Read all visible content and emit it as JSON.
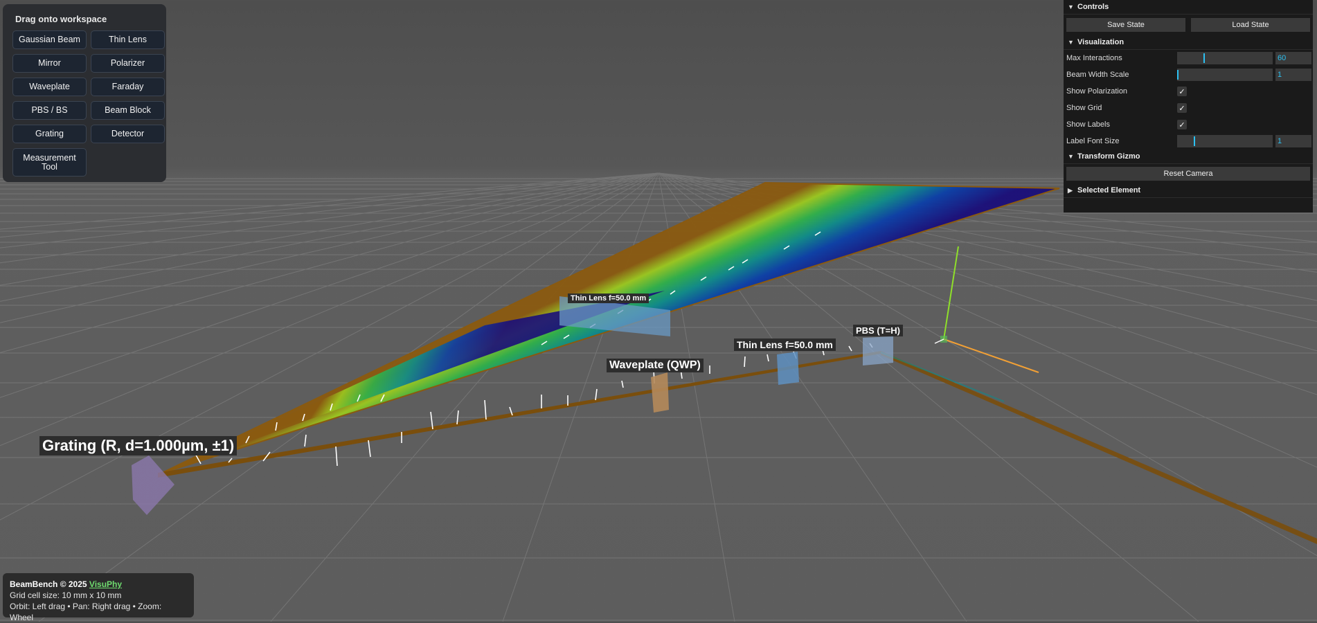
{
  "palette": {
    "title": "Drag onto workspace",
    "items": [
      {
        "label": "Gaussian Beam"
      },
      {
        "label": "Thin Lens"
      },
      {
        "label": "Mirror"
      },
      {
        "label": "Polarizer"
      },
      {
        "label": "Waveplate"
      },
      {
        "label": "Faraday"
      },
      {
        "label": "PBS / BS"
      },
      {
        "label": "Beam Block"
      },
      {
        "label": "Grating"
      },
      {
        "label": "Detector"
      },
      {
        "label": "Measurement Tool"
      }
    ]
  },
  "controls": {
    "title": "Controls",
    "save_label": "Save State",
    "load_label": "Load State",
    "visualization": {
      "title": "Visualization",
      "max_interactions_label": "Max Interactions",
      "max_interactions_value": "60",
      "beam_width_scale_label": "Beam Width Scale",
      "beam_width_scale_value": "1",
      "show_polarization_label": "Show Polarization",
      "show_grid_label": "Show Grid",
      "show_labels_label": "Show Labels",
      "label_font_size_label": "Label Font Size",
      "label_font_size_value": "1",
      "check_mark": "✓"
    },
    "transform_gizmo": {
      "title": "Transform Gizmo",
      "reset_camera_label": "Reset Camera"
    },
    "selected_element": {
      "title": "Selected Element"
    }
  },
  "scene_labels": {
    "grating": "Grating (R, d=1.000µm, ±1)",
    "thin_lens_far": "Thin Lens f=50.0 mm",
    "waveplate": "Waveplate (QWP)",
    "thin_lens_near": "Thin Lens f=50.0 mm",
    "pbs": "PBS (T=H)"
  },
  "info": {
    "app": "BeamBench © 2025",
    "link": "VisuPhy",
    "grid": "Grid cell size: 10 mm x 10 mm",
    "help": "Orbit: Left drag • Pan: Right drag • Zoom: Wheel"
  },
  "colors": {
    "beam_main": "#8a5a10",
    "spectrum": [
      "#1a0e7a",
      "#0b3fa8",
      "#0e8c8a",
      "#2fb14a",
      "#9cc91f",
      "#8a5a10"
    ],
    "gizmo_y": "#8fe02a",
    "gizmo_x": "#f2a035"
  }
}
